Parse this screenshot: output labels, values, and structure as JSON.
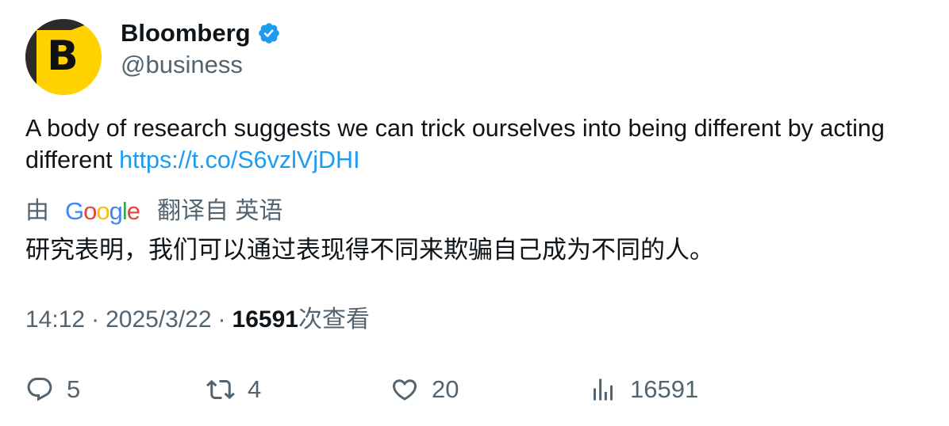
{
  "author": {
    "name": "Bloomberg",
    "handle": "@business",
    "avatar_letter": "B",
    "avatar_color": "#ffd200",
    "verified_icon": "verified-badge-icon",
    "verified_color": "#1d9bf0"
  },
  "tweet": {
    "text": "A body of research suggests we can trick ourselves into being different by acting different ",
    "link": "https://t.co/S6vzlVjDHI",
    "link_color": "#1d9bf0"
  },
  "translation": {
    "by_label": "由",
    "provider": "Google",
    "from_label": "翻译自 英语",
    "text": "研究表明，我们可以通过表现得不同来欺骗自己成为不同的人。"
  },
  "meta": {
    "time": "14:12",
    "separator": "·",
    "date": "2025/3/22",
    "views_count": "16591",
    "views_label": "次查看"
  },
  "actions": {
    "reply": {
      "icon": "reply-icon",
      "count": "5"
    },
    "retweet": {
      "icon": "retweet-icon",
      "count": "4"
    },
    "like": {
      "icon": "heart-icon",
      "count": "20"
    },
    "views": {
      "icon": "analytics-icon",
      "count": "16591"
    }
  }
}
